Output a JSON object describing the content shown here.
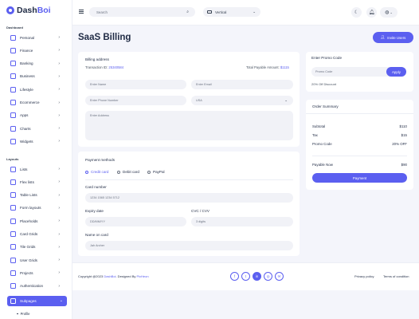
{
  "brand": {
    "prefix": "Dash",
    "suffix": "Boi"
  },
  "sidebar": {
    "dashboard_label": "Dashboard",
    "dashboard_items": [
      {
        "label": "Personal",
        "icon": "home-icon"
      },
      {
        "label": "Finance",
        "icon": "chart-icon"
      },
      {
        "label": "Banking",
        "icon": "bank-icon"
      },
      {
        "label": "Business",
        "icon": "briefcase-icon"
      },
      {
        "label": "Lifestyle",
        "icon": "heart-icon"
      },
      {
        "label": "Ecommerce",
        "icon": "cart-icon"
      },
      {
        "label": "Apps",
        "icon": "layers-icon"
      },
      {
        "label": "Charts",
        "icon": "pie-icon"
      },
      {
        "label": "Widgets",
        "icon": "widget-icon"
      }
    ],
    "layouts_label": "Layouts",
    "layout_items": [
      {
        "label": "Lists",
        "icon": "list-icon"
      },
      {
        "label": "Flex lists",
        "icon": "flex-icon"
      },
      {
        "label": "Table Lists",
        "icon": "table-icon"
      },
      {
        "label": "Form layouts",
        "icon": "form-icon"
      },
      {
        "label": "Placeholds",
        "icon": "placeholder-icon"
      },
      {
        "label": "Card Grids",
        "icon": "card-icon"
      },
      {
        "label": "Tile Grids",
        "icon": "tile-icon"
      },
      {
        "label": "User Grids",
        "icon": "users-icon"
      },
      {
        "label": "Projects",
        "icon": "folder-icon"
      },
      {
        "label": "Authentication",
        "icon": "lock-icon"
      }
    ],
    "active_item": {
      "label": "Subpages",
      "icon": "page-icon"
    },
    "sub_item": "Profile"
  },
  "topbar": {
    "search_placeholder": "Search",
    "layout_select": "Vertical",
    "icons": [
      "menu-icon",
      "search-icon",
      "moon-icon",
      "bell-icon",
      "globe-icon"
    ]
  },
  "page": {
    "title": "SaaS Billing",
    "invite_label": "Invite Users"
  },
  "billing": {
    "heading": "Billing address",
    "transaction_label": "Transaction ID:",
    "transaction_id": "25340584",
    "payable_label": "Total Payable Amount:",
    "payable_amount": "$1115",
    "fields": {
      "name": "Enter Name",
      "email": "Enter Email",
      "phone": "Enter Phone Number",
      "country": "USA",
      "address": "Enter Address"
    }
  },
  "payment": {
    "heading": "Payment methods",
    "methods": [
      "Credit card",
      "Debit card",
      "PayPal"
    ],
    "card_number_label": "Card number",
    "card_number_value": "1234 1565 1234 5712",
    "expiry_label": "Expiry date",
    "expiry_value": "DD/MM/YY",
    "cvc_label": "CVC / CVV",
    "cvc_value": "3 digits",
    "name_label": "Name on card",
    "name_value": "Jah Archer"
  },
  "promo": {
    "heading": "Enter Promo Code",
    "placeholder": "Promo Code",
    "apply_label": "Apply",
    "note": "20% Off Discount"
  },
  "summary": {
    "heading": "Order Summary",
    "rows": [
      {
        "label": "Subtotal",
        "value": "$110"
      },
      {
        "label": "Tax",
        "value": "$15"
      },
      {
        "label": "Promo Code",
        "value": "20% OFF"
      }
    ],
    "payable_label": "Payable Now",
    "payable_value": "$90",
    "pay_label": "Payment"
  },
  "footer": {
    "copyright": "Copyright @2023",
    "brand_link": "DashBoi",
    "designed_by": ". Designed By",
    "designer": "PixHeon",
    "links": [
      "Privacy policy",
      "Terms of condition"
    ],
    "social": [
      {
        "icon": "facebook-icon",
        "glyph": "f"
      },
      {
        "icon": "twitter-icon",
        "glyph": "t"
      },
      {
        "icon": "linkedin-icon",
        "glyph": "in"
      },
      {
        "icon": "instagram-icon",
        "glyph": "◎"
      },
      {
        "icon": "dribbble-icon",
        "glyph": "✉"
      }
    ]
  },
  "colors": {
    "accent": "#5b5ff0",
    "background": "#f4f5fb",
    "text": "#1f2a44"
  }
}
